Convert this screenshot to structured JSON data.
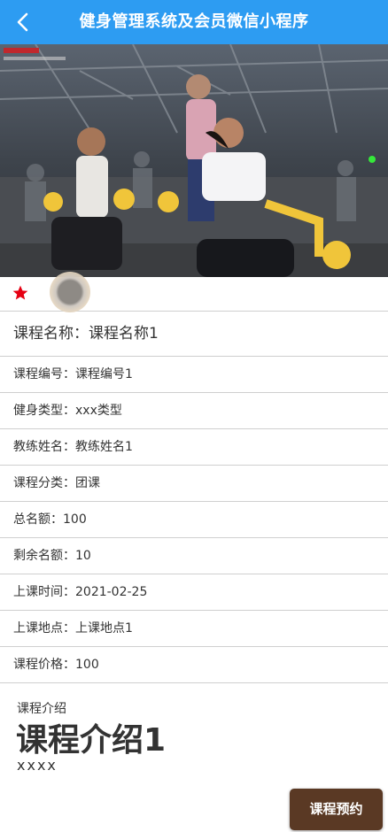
{
  "header": {
    "title": "健身管理系统及会员微信小程序"
  },
  "course": {
    "name_label": "课程名称：",
    "name": "课程名称1",
    "fields": [
      {
        "label": "课程编号：",
        "value": "课程编号1"
      },
      {
        "label": "健身类型：",
        "value": "xxx类型"
      },
      {
        "label": "教练姓名：",
        "value": "教练姓名1"
      },
      {
        "label": "课程分类：",
        "value": "团课"
      },
      {
        "label": "总名额：",
        "value": "100"
      },
      {
        "label": "剩余名额：",
        "value": "10"
      },
      {
        "label": "上课时间：",
        "value": "2021-02-25"
      },
      {
        "label": "上课地点：",
        "value": "上课地点1"
      },
      {
        "label": "课程价格：",
        "value": "100"
      }
    ]
  },
  "intro": {
    "label": "课程介绍",
    "heading": "课程介绍1",
    "text": "xxxx"
  },
  "actions": {
    "book_label": "课程预约"
  },
  "colors": {
    "header": "#2d9cf2",
    "button": "#5a3924",
    "star": "#e60012"
  }
}
